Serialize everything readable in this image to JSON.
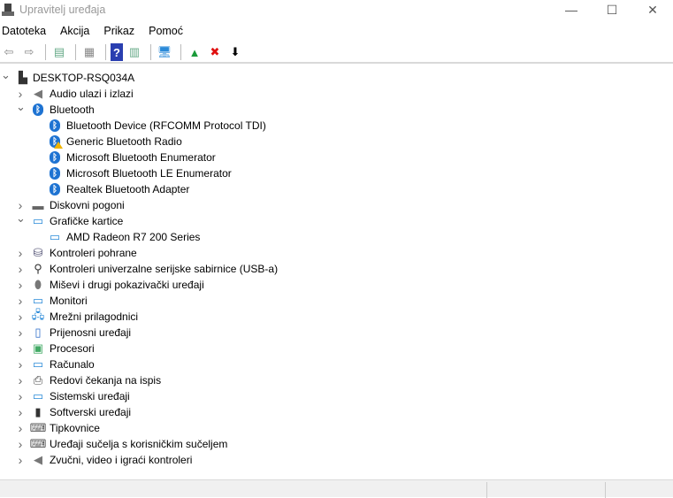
{
  "window": {
    "title": "Upravitelj uređaja",
    "minimize": "—",
    "maximize": "☐",
    "close": "✕"
  },
  "menu": [
    "Datoteka",
    "Akcija",
    "Prikaz",
    "Pomoć"
  ],
  "toolbar": [
    {
      "name": "back-icon",
      "glyph": "⇦",
      "color": "#888"
    },
    {
      "name": "forward-icon",
      "glyph": "⇨",
      "color": "#888"
    },
    {
      "sep": true
    },
    {
      "name": "show-hide-console-tree-icon",
      "glyph": "▤",
      "color": "#6a8"
    },
    {
      "sep": true
    },
    {
      "name": "properties-icon",
      "glyph": "▦",
      "color": "#888"
    },
    {
      "sep": true
    },
    {
      "name": "help-icon",
      "glyph": "?",
      "color": "#fff",
      "bg": "#2a3fb0"
    },
    {
      "name": "action-pane-icon",
      "glyph": "▥",
      "color": "#6a8"
    },
    {
      "sep": true
    },
    {
      "name": "scan-hardware-icon",
      "glyph": "🖥",
      "color": "#2a8ad8"
    },
    {
      "sep": true
    },
    {
      "name": "update-driver-icon",
      "glyph": "▲",
      "color": "#1a9a3a"
    },
    {
      "name": "uninstall-device-icon",
      "glyph": "✖",
      "color": "#e01010"
    },
    {
      "name": "disable-device-icon",
      "glyph": "⬇",
      "color": "#000"
    }
  ],
  "tree": [
    {
      "level": 0,
      "expanded": true,
      "label": "DESKTOP-RSQ034A",
      "icon": "computer"
    },
    {
      "level": 1,
      "expanded": false,
      "label": "Audio ulazi i izlazi",
      "icon": "speaker"
    },
    {
      "level": 1,
      "expanded": true,
      "label": "Bluetooth",
      "icon": "bluetooth"
    },
    {
      "level": 2,
      "label": "Bluetooth Device (RFCOMM Protocol TDI)",
      "icon": "bluetooth"
    },
    {
      "level": 2,
      "label": "Generic Bluetooth Radio",
      "icon": "bluetooth-warning"
    },
    {
      "level": 2,
      "label": "Microsoft Bluetooth Enumerator",
      "icon": "bluetooth"
    },
    {
      "level": 2,
      "label": "Microsoft Bluetooth LE Enumerator",
      "icon": "bluetooth"
    },
    {
      "level": 2,
      "label": "Realtek Bluetooth Adapter",
      "icon": "bluetooth"
    },
    {
      "level": 1,
      "expanded": false,
      "label": "Diskovni pogoni",
      "icon": "disk"
    },
    {
      "level": 1,
      "expanded": true,
      "label": "Grafičke kartice",
      "icon": "display-adapter"
    },
    {
      "level": 2,
      "label": "AMD Radeon R7 200 Series",
      "icon": "display-adapter"
    },
    {
      "level": 1,
      "expanded": false,
      "label": "Kontroleri pohrane",
      "icon": "storage"
    },
    {
      "level": 1,
      "expanded": false,
      "label": "Kontroleri univerzalne serijske sabirnice (USB-a)",
      "icon": "usb"
    },
    {
      "level": 1,
      "expanded": false,
      "label": "Miševi i drugi pokazivački uređaji",
      "icon": "mouse"
    },
    {
      "level": 1,
      "expanded": false,
      "label": "Monitori",
      "icon": "monitor"
    },
    {
      "level": 1,
      "expanded": false,
      "label": "Mrežni prilagodnici",
      "icon": "network"
    },
    {
      "level": 1,
      "expanded": false,
      "label": "Prijenosni uređaji",
      "icon": "portable"
    },
    {
      "level": 1,
      "expanded": false,
      "label": "Procesori",
      "icon": "processor"
    },
    {
      "level": 1,
      "expanded": false,
      "label": "Računalo",
      "icon": "computer-monitor"
    },
    {
      "level": 1,
      "expanded": false,
      "label": "Redovi čekanja na ispis",
      "icon": "printer"
    },
    {
      "level": 1,
      "expanded": false,
      "label": "Sistemski uređaji",
      "icon": "system"
    },
    {
      "level": 1,
      "expanded": false,
      "label": "Softverski uređaji",
      "icon": "software"
    },
    {
      "level": 1,
      "expanded": false,
      "label": "Tipkovnice",
      "icon": "keyboard"
    },
    {
      "level": 1,
      "expanded": false,
      "label": "Uređaji sučelja s korisničkim sučeljem",
      "icon": "hid"
    },
    {
      "level": 1,
      "expanded": false,
      "label": "Zvučni, video i igraći kontroleri",
      "icon": "speaker"
    }
  ]
}
